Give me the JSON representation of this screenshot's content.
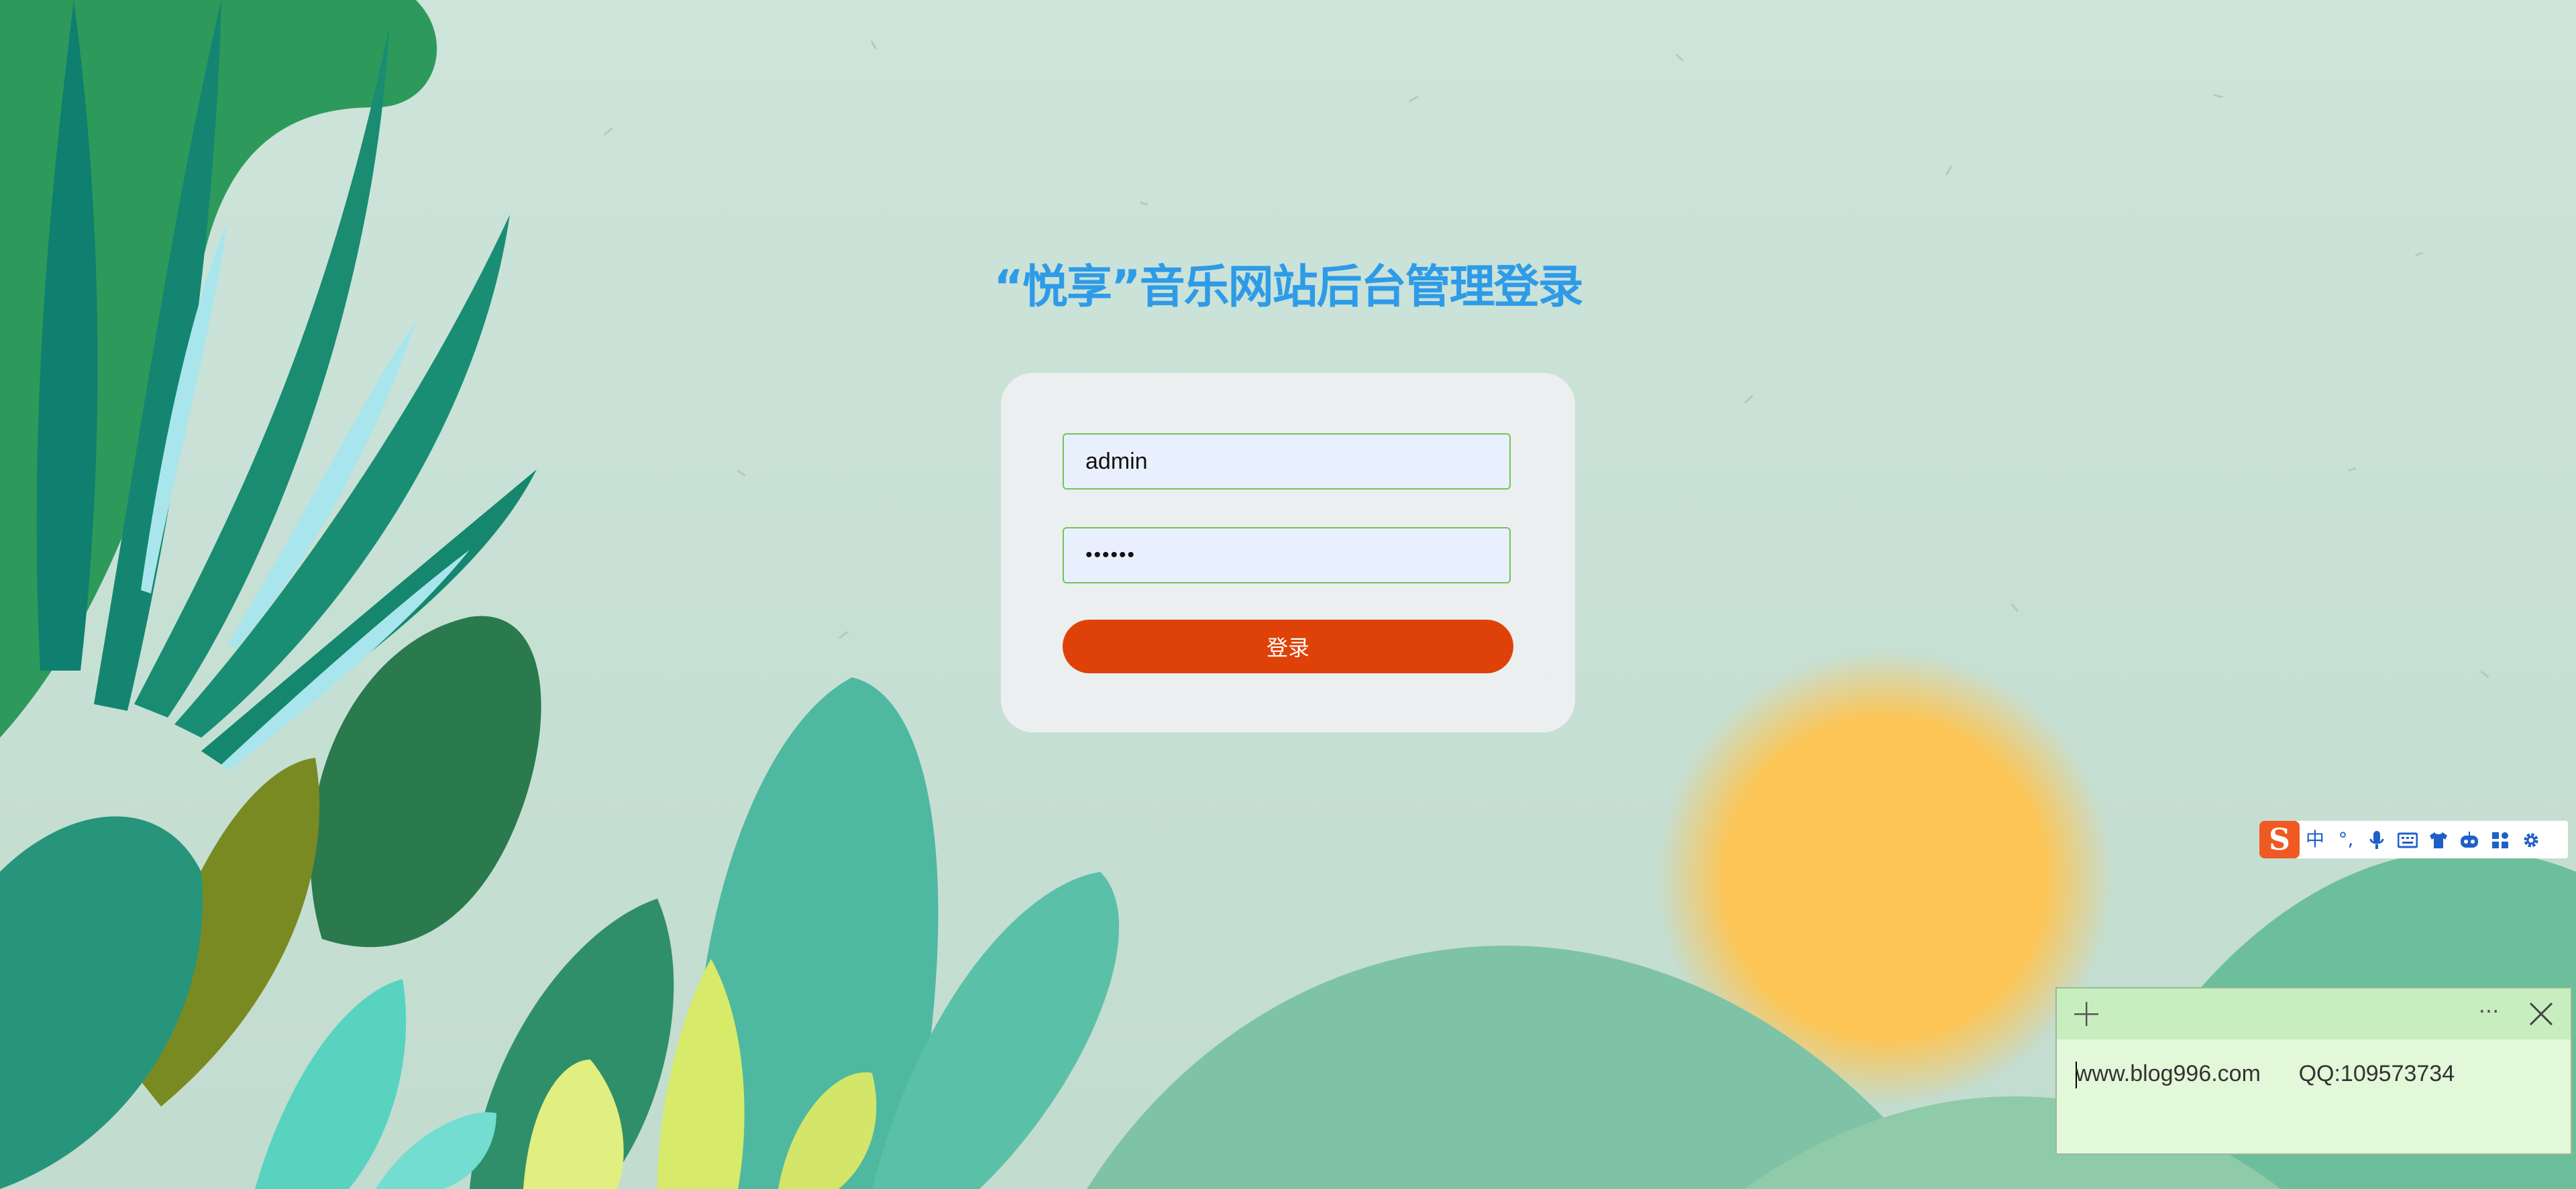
{
  "page": {
    "title": "“悦享”音乐网站后台管理登录"
  },
  "login_form": {
    "username_value": "admin",
    "password_value": "••••••",
    "submit_label": "登录"
  },
  "ime_toolbar": {
    "logo": "S",
    "mode_label": "中",
    "punctuation_label": "°,",
    "icons": [
      "sogou-logo-icon",
      "chinese-mode-icon",
      "punctuation-icon",
      "microphone-icon",
      "keyboard-icon",
      "skin-shirt-icon",
      "robot-icon",
      "toolbox-grid-icon",
      "settings-gear-icon"
    ]
  },
  "sticky_note": {
    "content_line": "www.blog996.com      QQ:109573734",
    "more_label": "···"
  },
  "colors": {
    "title": "#2e9be8",
    "button": "#df4208",
    "input_border": "#72c45a",
    "input_bg": "#e9f0fd",
    "sticky_bg": "#e3f7d9",
    "sticky_header": "#c8eec0",
    "sun": "#fcc555"
  }
}
